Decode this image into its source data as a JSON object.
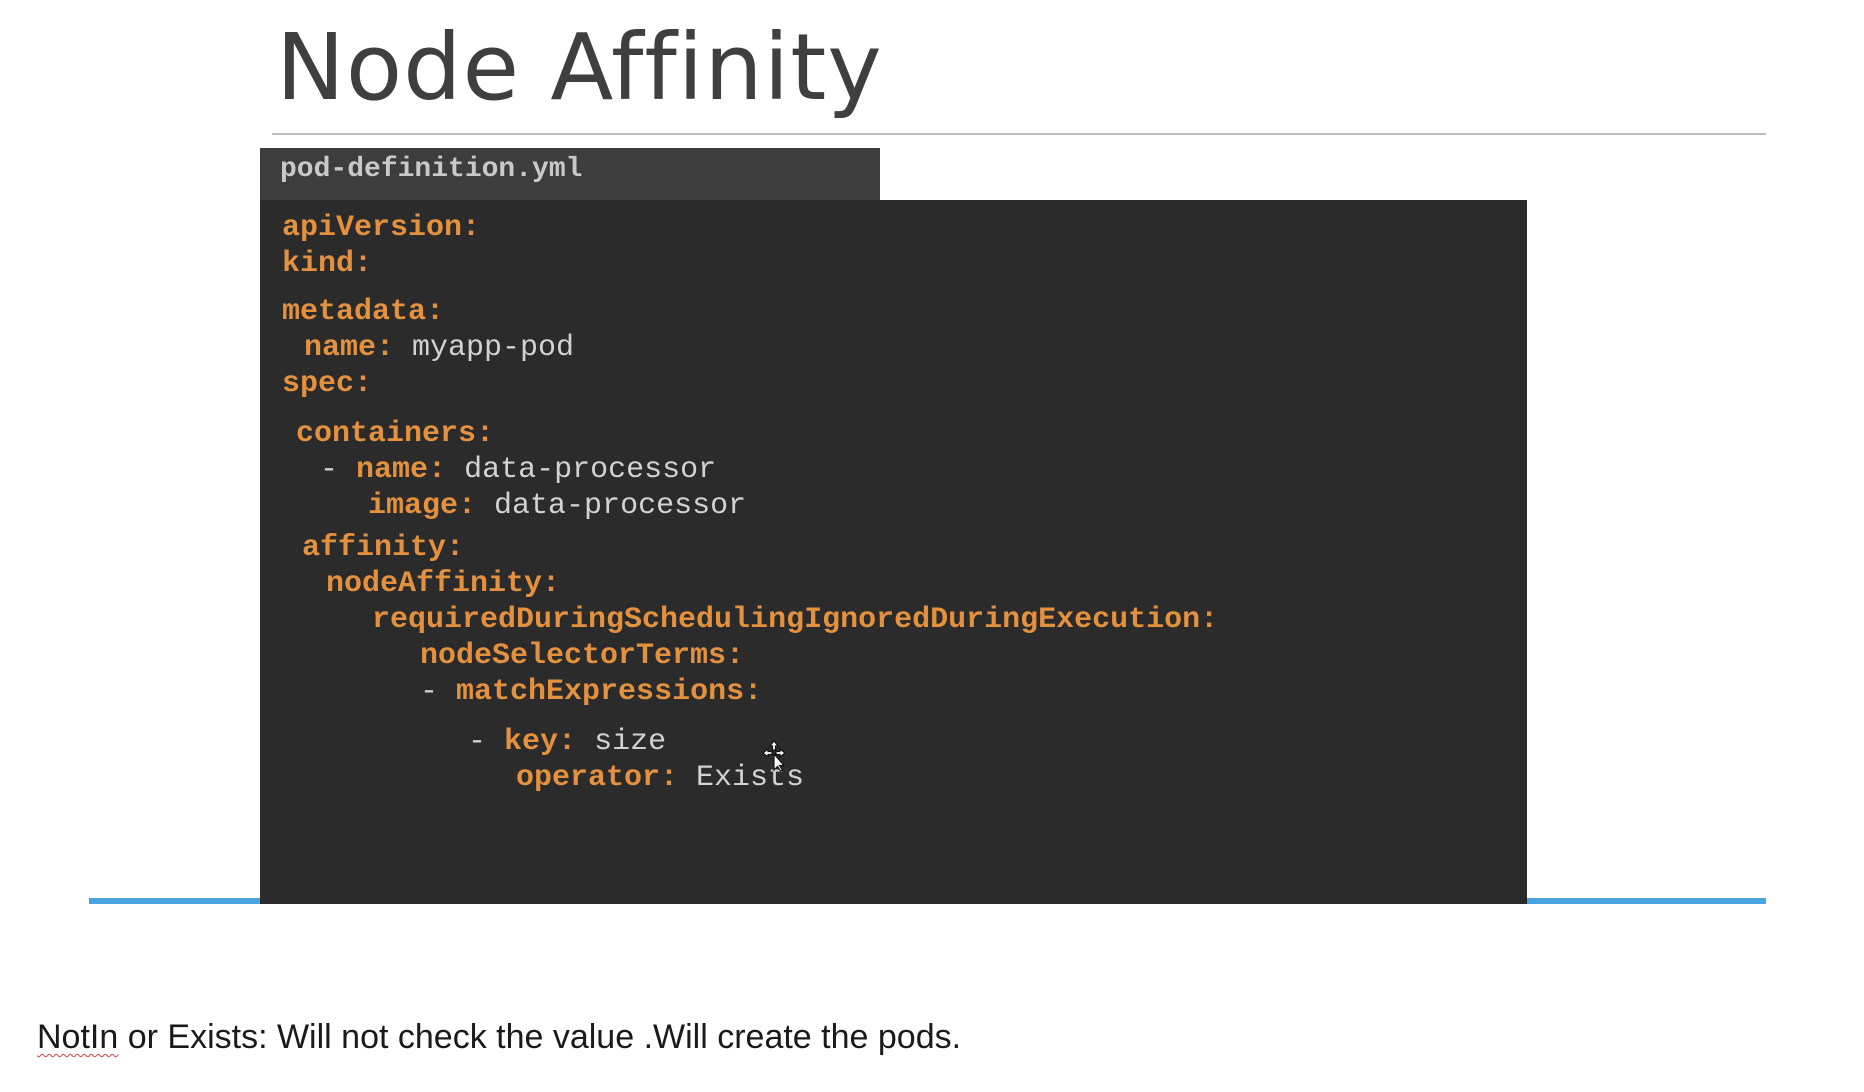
{
  "slide": {
    "title": "Node Affinity"
  },
  "file_tab": {
    "label": "pod-definition.yml"
  },
  "code": {
    "api_version_key": "apiVersion:",
    "kind_key": "kind:",
    "metadata_key": "metadata:",
    "name_key": "name:",
    "name_value": "myapp-pod",
    "spec_key": "spec:",
    "containers_key": "containers:",
    "container_dash": "-",
    "container_name_key": "name:",
    "container_name_value": "data-processor",
    "image_key": "image:",
    "image_value": "data-processor",
    "affinity_key": "affinity:",
    "node_affinity_key": "nodeAffinity:",
    "required_key": "requiredDuringSchedulingIgnoredDuringExecution:",
    "node_selector_terms_key": "nodeSelectorTerms:",
    "match_dash": "-",
    "match_expressions_key": "matchExpressions:",
    "key_dash": "-",
    "key_key": "key:",
    "key_value": "size",
    "operator_key": "operator:",
    "operator_value": "Exists"
  },
  "caption": {
    "underlined_word": "NotIn",
    "rest": " or Exists: Will not check the value .Will create the pods."
  },
  "colors": {
    "code_key": "#e3903f",
    "code_value": "#d2d2d2",
    "code_background": "#2b2b2b",
    "file_tab_background": "#3d3d3d",
    "accent_line": "#4aa3de",
    "title_text": "#3f3f3f"
  },
  "icons": {
    "cursor": "move-cursor-icon"
  }
}
